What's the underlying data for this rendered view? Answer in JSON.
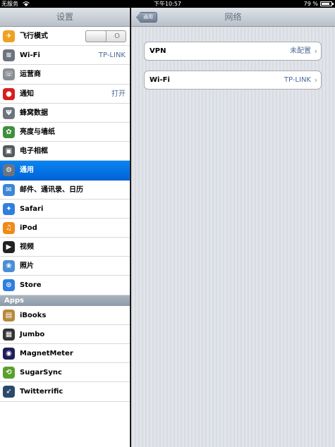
{
  "status": {
    "carrier": "无服务",
    "time": "下午10:57",
    "battery": "79 %"
  },
  "left": {
    "title": "设置",
    "items": [
      {
        "label": "飞行模式",
        "icon": "airplane-icon",
        "color": "#f0a020",
        "glyph": "✈",
        "switch": "O"
      },
      {
        "label": "Wi-Fi",
        "icon": "wifi-icon",
        "color": "#6d7480",
        "glyph": "≋",
        "detail": "TP-LINK"
      },
      {
        "label": "运营商",
        "icon": "phone-icon",
        "color": "#8a8f96",
        "glyph": "☏"
      },
      {
        "label": "通知",
        "icon": "notification-icon",
        "color": "#d81e1e",
        "glyph": "●",
        "detail": "打开"
      },
      {
        "label": "蜂窝数据",
        "icon": "antenna-icon",
        "color": "#6d7480",
        "glyph": "Ψ"
      },
      {
        "label": "亮度与墙纸",
        "icon": "flower-icon",
        "color": "#3f8f3f",
        "glyph": "✿"
      },
      {
        "label": "电子相框",
        "icon": "photo-frame-icon",
        "color": "#555a60",
        "glyph": "▣"
      },
      {
        "label": "通用",
        "icon": "gear-icon",
        "color": "#6d7480",
        "glyph": "⚙",
        "selected": true
      },
      {
        "label": "邮件、通讯录、日历",
        "icon": "mail-icon",
        "color": "#3b86d6",
        "glyph": "✉"
      },
      {
        "label": "Safari",
        "icon": "compass-icon",
        "color": "#2f7fe0",
        "glyph": "✦"
      },
      {
        "label": "iPod",
        "icon": "ipod-icon",
        "color": "#f08a18",
        "glyph": "♫"
      },
      {
        "label": "视频",
        "icon": "video-icon",
        "color": "#222222",
        "glyph": "▶"
      },
      {
        "label": "照片",
        "icon": "sunflower-icon",
        "color": "#4a8fd6",
        "glyph": "❀"
      },
      {
        "label": "Store",
        "icon": "store-icon",
        "color": "#2f7fe0",
        "glyph": "⊙"
      }
    ],
    "apps_header": "Apps",
    "apps": [
      {
        "label": "iBooks",
        "icon": "book-icon",
        "color": "#b8893a",
        "glyph": "▤"
      },
      {
        "label": "Jumbo",
        "icon": "jumbo-icon",
        "color": "#333333",
        "glyph": "▦"
      },
      {
        "label": "MagnetMeter",
        "icon": "magnet-icon",
        "color": "#1e1e5a",
        "glyph": "◉"
      },
      {
        "label": "SugarSync",
        "icon": "sync-icon",
        "color": "#5aa02c",
        "glyph": "⟲"
      },
      {
        "label": "Twitterrific",
        "icon": "bird-icon",
        "color": "#2a4a6a",
        "glyph": "➶"
      }
    ]
  },
  "right": {
    "title": "网络",
    "back_label": "通用",
    "vpn": {
      "label": "VPN",
      "value": "未配置"
    },
    "wifi": {
      "label": "Wi-Fi",
      "value": "TP-LINK"
    },
    "chevron": "›"
  }
}
